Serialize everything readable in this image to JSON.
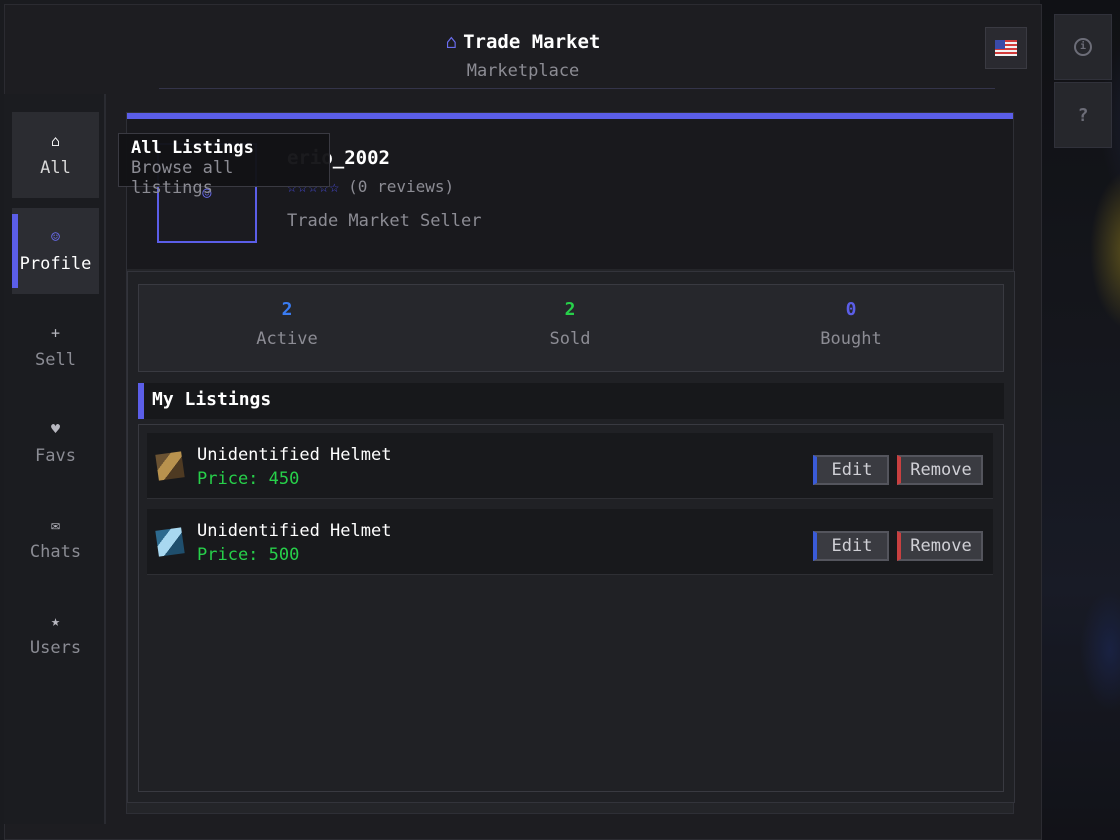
{
  "header": {
    "title_icon": "⌂",
    "title": "Trade Market",
    "subtitle": "Marketplace",
    "language_flag": "us-flag-icon",
    "info_icon": "i",
    "help_icon": "?"
  },
  "sidebar": {
    "items": [
      {
        "id": "all",
        "icon": "⌂",
        "label": "All"
      },
      {
        "id": "profile",
        "icon": "☺",
        "label": "Profile"
      },
      {
        "id": "sell",
        "icon": "+",
        "label": "Sell"
      },
      {
        "id": "favs",
        "icon": "♥",
        "label": "Favs"
      },
      {
        "id": "chats",
        "icon": "✉",
        "label": "Chats"
      },
      {
        "id": "users",
        "icon": "★",
        "label": "Users"
      }
    ]
  },
  "tooltip": {
    "title": "All Listings",
    "description": "Browse all listings"
  },
  "profile": {
    "avatar_glyph": "☺",
    "username_visible": "erio_2002",
    "stars": "☆☆☆☆☆",
    "rating_count": 0,
    "reviews_text": "(0 reviews)",
    "role": "Trade Market Seller"
  },
  "stats": [
    {
      "value": "2",
      "label": "Active",
      "color": "#3a7cf2"
    },
    {
      "value": "2",
      "label": "Sold",
      "color": "#27d04a"
    },
    {
      "value": "0",
      "label": "Bought",
      "color": "#5b5ee8"
    }
  ],
  "listings_section": {
    "title": "My Listings",
    "items": [
      {
        "name": "Unidentified Helmet",
        "price": "Price: 450",
        "icon": "brown-helmet-icon",
        "edit_label": "Edit",
        "remove_label": "Remove"
      },
      {
        "name": "Unidentified Helmet",
        "price": "Price: 500",
        "icon": "cyan-helmet-icon",
        "edit_label": "Edit",
        "remove_label": "Remove"
      }
    ]
  },
  "colors": {
    "accent": "#5b5ee8",
    "price": "#27d04a",
    "edit_accent": "#3a5bd8",
    "remove_accent": "#c84040"
  }
}
